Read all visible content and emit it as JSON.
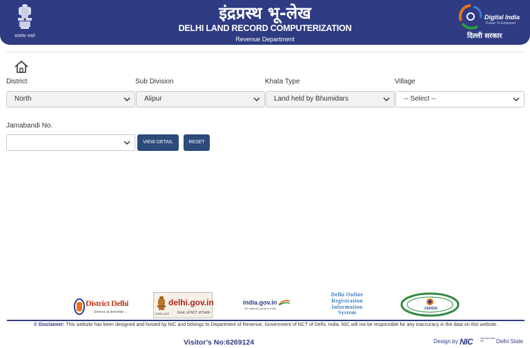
{
  "header": {
    "emblem_caption": "सत्यमेव जयते",
    "title_hindi": "इंद्रप्रस्थ भू-लेख",
    "title_english": "DELHI LAND RECORD COMPUTERIZATION",
    "department": "Revenue Department",
    "digital_india": {
      "name": "Digital India",
      "tagline": "Power To Empower",
      "sarkar": "दिल्ली सरकार"
    }
  },
  "form": {
    "district": {
      "label": "District",
      "value": "North"
    },
    "sub_division": {
      "label": "Sub Division",
      "value": "Alipur"
    },
    "khata_type": {
      "label": "Khata Type",
      "value": "Land held by Bhumidars"
    },
    "village": {
      "label": "Village",
      "value": "-- Select --"
    },
    "jamabandi": {
      "label": "Jamabandi No.",
      "value": ""
    },
    "view_detail_label": "VIEW DETAIL",
    "reset_label": "RESET"
  },
  "footer": {
    "logos": {
      "district_delhi": {
        "name": "District Delhi",
        "tagline": "Service at doorstep ..."
      },
      "delhi_gov": {
        "name": "delhi.gov.in",
        "tagline": "Govt. of NCT of Delhi",
        "caption": "सत्यमेव जयते"
      },
      "india_gov": {
        "name": "india.gov.in",
        "tagline": "the national portal of India"
      },
      "doris": {
        "line1": "Delhi Online",
        "line2": "Registration",
        "line3": "Information",
        "line4": "System"
      },
      "cersai": {
        "name": "CERSAI"
      }
    },
    "disclaimer_label": "© Disclaimer:",
    "disclaimer_text": "This website has been designed and hosted by NIC and belongs to Department of Revenue, Government of NCT of Delhi, India. NIC will not be responsible for any inaccuracy in the data on this website.",
    "visitor_label": "Visitor's No:",
    "visitor_count": "6269124",
    "design_by": "Design by",
    "nic": "NIC",
    "nic_small": "राष्ट्रीय सूचना विज्ञान केन्द्र",
    "delhi_state": "Delhi State"
  },
  "colors": {
    "header_bg": "#2f3b82",
    "button_bg": "#2c4a7a",
    "accent_orange": "#e8731a",
    "accent_green": "#2e9a3e"
  }
}
